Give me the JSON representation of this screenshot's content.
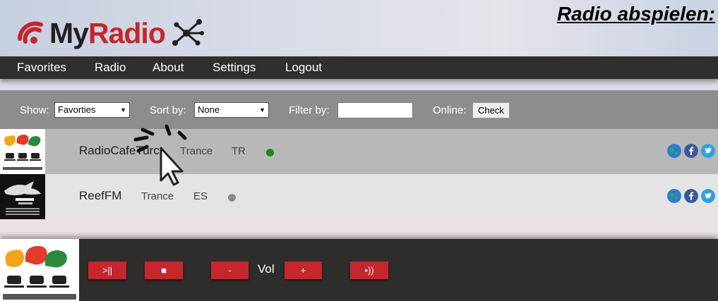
{
  "header": {
    "logo_my": "My",
    "logo_radio": "Radio",
    "page_heading": "Radio abspielen:"
  },
  "nav": {
    "items": [
      "Favorites",
      "Radio",
      "About",
      "Settings",
      "Logout"
    ]
  },
  "filters": {
    "show_label": "Show:",
    "show_value": "Favorties",
    "sort_label": "Sort by:",
    "sort_value": "None",
    "filter_label": "Filter by:",
    "filter_value": "",
    "online_label": "Online:",
    "check_label": "Check"
  },
  "stations": [
    {
      "name": "RadioCafeTurc",
      "genre": "Trance",
      "country": "TR",
      "status": "online",
      "status_color": "#1a8a1a"
    },
    {
      "name": "ReefFM",
      "genre": "Trance",
      "country": "ES",
      "status": "offline",
      "status_color": "#8a8a8a"
    }
  ],
  "player": {
    "play_pause": ">||",
    "stop": "■",
    "vol_down": "-",
    "vol_label": "Vol",
    "vol_up": "+",
    "mute": "•))"
  },
  "colors": {
    "accent": "#c6262c",
    "nav_bg": "#312e2e",
    "filter_bg": "#8d8d8d",
    "row1_bg": "#b8b8b8",
    "row2_bg": "#e4e4e4"
  }
}
